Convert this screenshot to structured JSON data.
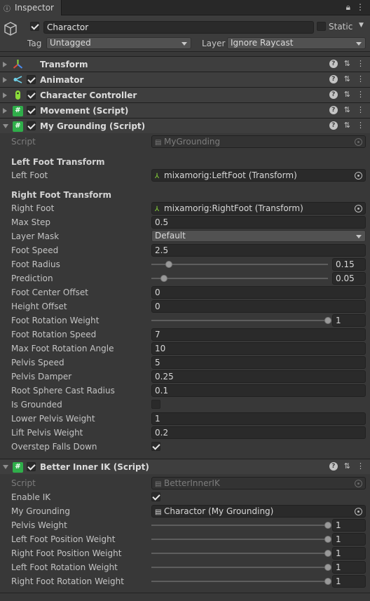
{
  "tab": {
    "title": "Inspector",
    "icon": "info-icon"
  },
  "gameobject": {
    "name": "Charactor",
    "active": true,
    "static_label": "Static",
    "static": false,
    "tag_label": "Tag",
    "tag_value": "Untagged",
    "layer_label": "Layer",
    "layer_value": "Ignore Raycast"
  },
  "components": {
    "transform": {
      "title": "Transform"
    },
    "animator": {
      "title": "Animator"
    },
    "character_controller": {
      "title": "Character Controller"
    },
    "movement": {
      "title": "Movement (Script)"
    },
    "my_grounding": {
      "title": "My Grounding (Script)"
    },
    "better_inner_ik": {
      "title": "Better Inner IK (Script)"
    }
  },
  "grounding": {
    "script_label": "Script",
    "script_value": "MyGrounding",
    "left_foot_section": "Left Foot Transform",
    "left_foot_label": "Left Foot",
    "left_foot_value": "mixamorig:LeftFoot (Transform)",
    "right_foot_section": "Right Foot Transform",
    "right_foot_label": "Right Foot",
    "right_foot_value": "mixamorig:RightFoot (Transform)",
    "max_step_label": "Max Step",
    "max_step_value": "0.5",
    "layer_mask_label": "Layer Mask",
    "layer_mask_value": "Default",
    "foot_speed_label": "Foot Speed",
    "foot_speed_value": "2.5",
    "foot_radius_label": "Foot Radius",
    "foot_radius_value": "0.15",
    "foot_radius_fraction": 0.1,
    "prediction_label": "Prediction",
    "prediction_value": "0.05",
    "prediction_fraction": 0.07,
    "foot_center_offset_label": "Foot Center Offset",
    "foot_center_offset_value": "0",
    "height_offset_label": "Height Offset",
    "height_offset_value": "0",
    "foot_rotation_weight_label": "Foot Rotation Weight",
    "foot_rotation_weight_value": "1",
    "foot_rotation_weight_fraction": 1.0,
    "foot_rotation_speed_label": "Foot Rotation Speed",
    "foot_rotation_speed_value": "7",
    "max_foot_rotation_angle_label": "Max Foot Rotation Angle",
    "max_foot_rotation_angle_value": "10",
    "pelvis_speed_label": "Pelvis Speed",
    "pelvis_speed_value": "5",
    "pelvis_damper_label": "Pelvis Damper",
    "pelvis_damper_value": "0.25",
    "root_sphere_cast_radius_label": "Root Sphere Cast Radius",
    "root_sphere_cast_radius_value": "0.1",
    "is_grounded_label": "Is Grounded",
    "is_grounded": false,
    "lower_pelvis_weight_label": "Lower Pelvis Weight",
    "lower_pelvis_weight_value": "1",
    "lift_pelvis_weight_label": "Lift Pelvis Weight",
    "lift_pelvis_weight_value": "0.2",
    "overstep_falls_down_label": "Overstep Falls Down",
    "overstep_falls_down": true
  },
  "ik": {
    "script_label": "Script",
    "script_value": "BetterInnerIK",
    "enable_ik_label": "Enable IK",
    "enable_ik": true,
    "my_grounding_label": "My Grounding",
    "my_grounding_value": "Charactor (My Grounding)",
    "pelvis_weight_label": "Pelvis Weight",
    "pelvis_weight_value": "1",
    "left_foot_position_weight_label": "Left Foot Position Weight",
    "left_foot_position_weight_value": "1",
    "right_foot_position_weight_label": "Right Foot Position Weight",
    "right_foot_position_weight_value": "1",
    "left_foot_rotation_weight_label": "Left Foot Rotation Weight",
    "left_foot_rotation_weight_value": "1",
    "right_foot_rotation_weight_label": "Right Foot Rotation Weight",
    "right_foot_rotation_weight_value": "1"
  },
  "colors": {
    "script_green": "#2fae4a",
    "transform_red": "#e04a3a",
    "controller_green": "#8bdc3a"
  }
}
